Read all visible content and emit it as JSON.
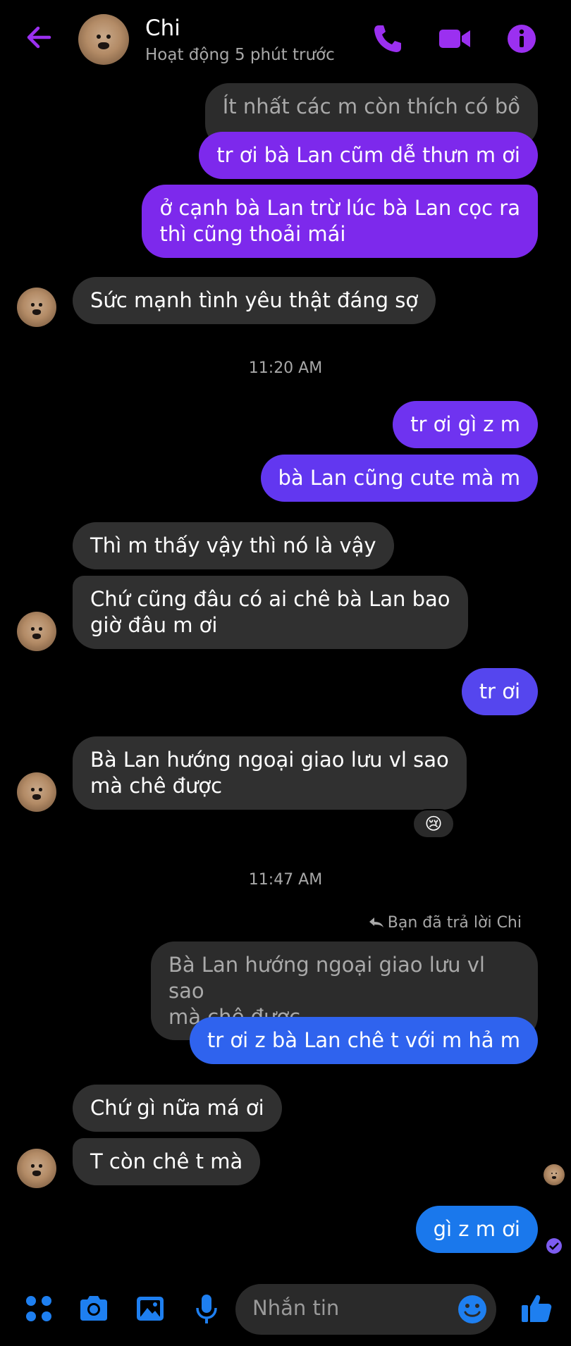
{
  "header": {
    "name": "Chi",
    "status": "Hoạt động 5 phút trước"
  },
  "messages": {
    "m1": "Ít nhất các m còn thích có bồ",
    "m2": "tr ơi bà Lan cũm dễ thưn m ơi",
    "m3a": "ở cạnh bà Lan trừ lúc bà Lan cọc ra",
    "m3b": "thì cũng thoải mái",
    "m4": "Sức mạnh tình yêu thật đáng sợ",
    "ts1": "11:20 AM",
    "m5": "tr ơi gì z m",
    "m6": "bà Lan cũng cute mà m",
    "m7": "Thì m thấy vậy thì nó là vậy",
    "m8a": "Chứ cũng đâu có ai chê bà Lan bao",
    "m8b": "giờ đâu m ơi",
    "m9": "tr ơi",
    "m10a": "Bà Lan hướng ngoại giao lưu vl sao",
    "m10b": "mà chê được",
    "reaction": "😢",
    "ts2": "11:47 AM",
    "replied_label": "Bạn đã trả lời Chi",
    "quote_a": "Bà Lan hướng ngoại giao lưu vl sao",
    "quote_b": "mà chê được",
    "m11": "tr ơi z bà Lan chê t với m hả m",
    "m12": "Chứ gì nữa má ơi",
    "m13": "T còn chê t mà",
    "m14": "gì z m ơi"
  },
  "composer": {
    "placeholder": "Nhắn tin"
  },
  "icons": {
    "back": "back-arrow-icon",
    "call": "phone-icon",
    "video": "video-camera-icon",
    "info": "info-icon",
    "menu": "four-dots-icon",
    "camera": "camera-icon",
    "gallery": "image-icon",
    "mic": "microphone-icon",
    "emoji": "smiley-icon",
    "like": "thumbs-up-icon"
  },
  "colors": {
    "accent": "#8a2be2",
    "incoming_bubble": "#303030",
    "outgoing_top": "#7d29ec",
    "outgoing_bottom": "#1a78ec",
    "composer_icon": "#1e7ff0"
  }
}
